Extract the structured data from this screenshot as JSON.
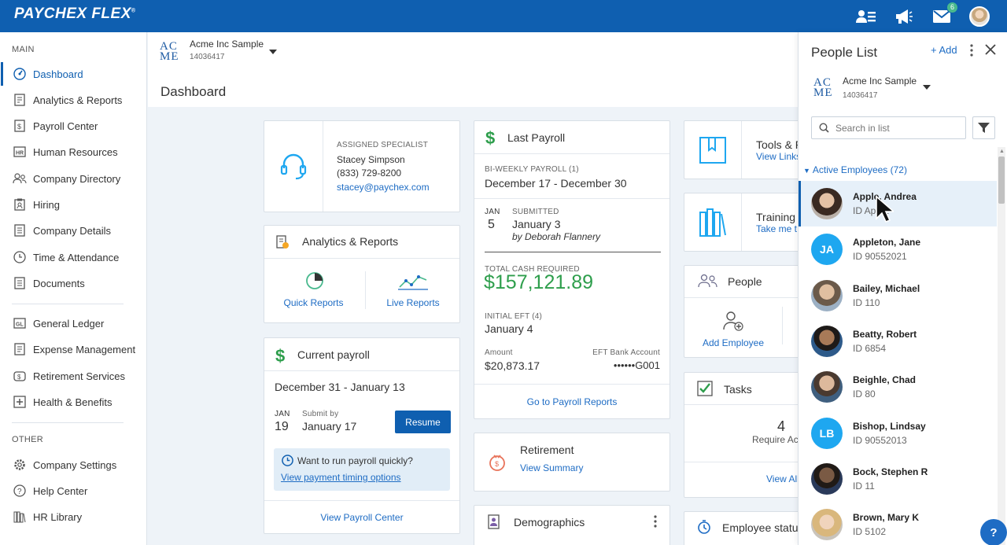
{
  "app": {
    "logo": "PAYCHEX FLEX",
    "logo_mark": "®"
  },
  "topbar": {
    "messages_badge": "6"
  },
  "sidebar": {
    "main_label": "MAIN",
    "other_label": "OTHER",
    "main_items": [
      {
        "label": "Dashboard",
        "icon": "dashboard-icon"
      },
      {
        "label": "Analytics & Reports",
        "icon": "report-icon"
      },
      {
        "label": "Payroll Center",
        "icon": "payroll-icon"
      },
      {
        "label": "Human Resources",
        "icon": "hr-icon"
      },
      {
        "label": "Company Directory",
        "icon": "directory-icon"
      },
      {
        "label": "Hiring",
        "icon": "hiring-icon"
      },
      {
        "label": "Company Details",
        "icon": "details-icon"
      },
      {
        "label": "Time & Attendance",
        "icon": "clock-icon"
      },
      {
        "label": "Documents",
        "icon": "documents-icon"
      },
      {
        "label": "General Ledger",
        "icon": "ledger-icon"
      },
      {
        "label": "Expense Management",
        "icon": "expense-icon"
      },
      {
        "label": "Retirement Services",
        "icon": "retirement-icon"
      },
      {
        "label": "Health & Benefits",
        "icon": "health-icon"
      }
    ],
    "other_items": [
      {
        "label": "Company Settings",
        "icon": "gear-icon"
      },
      {
        "label": "Help Center",
        "icon": "help-icon"
      },
      {
        "label": "HR Library",
        "icon": "library-icon"
      }
    ]
  },
  "company": {
    "logo_top": "AC",
    "logo_bottom": "ME",
    "name": "Acme Inc Sample",
    "id": "14036417"
  },
  "page_title": "Dashboard",
  "specialist": {
    "label": "ASSIGNED SPECIALIST",
    "name": "Stacey Simpson",
    "phone": "(833) 729-8200",
    "email": "stacey@paychex.com"
  },
  "analytics": {
    "title": "Analytics & Reports",
    "quick": "Quick Reports",
    "live": "Live Reports"
  },
  "current_payroll": {
    "title": "Current payroll",
    "period": "December 31 - January 13",
    "month": "JAN",
    "day": "19",
    "submit_label": "Submit by",
    "submit_date": "January 17",
    "button": "Resume",
    "quick_q": "Want to run payroll quickly?",
    "quick_link": "View payment timing options",
    "footer": "View Payroll Center"
  },
  "last_payroll": {
    "title": "Last Payroll",
    "freq": "BI-WEEKLY PAYROLL (1)",
    "period": "December 17 - December 30",
    "month": "JAN",
    "day": "5",
    "status": "SUBMITTED",
    "date": "January 3",
    "by": "by  Deborah Flannery",
    "cash_label": "TOTAL CASH REQUIRED",
    "cash": "$157,121.89",
    "eft_label": "INITIAL EFT (4)",
    "eft_date": "January 4",
    "amount_label": "Amount",
    "amount": "$20,873.17",
    "account_label": "EFT Bank Account",
    "account": "••••••G001",
    "footer": "Go to Payroll Reports"
  },
  "tools": {
    "title": "Tools & R",
    "link": "View Links"
  },
  "training": {
    "title": "Training",
    "link": "Take me t"
  },
  "people_card": {
    "title": "People",
    "add": "Add Employee"
  },
  "tasks": {
    "title": "Tasks",
    "count": "4",
    "sub": "Require Ac",
    "footer": "View All"
  },
  "employee_status": {
    "title": "Employee status"
  },
  "retirement": {
    "title": "Retirement",
    "link": "View Summary"
  },
  "demographics": {
    "title": "Demographics"
  },
  "people_list": {
    "title": "People List",
    "add": "+ Add",
    "search_placeholder": "Search in list",
    "group": "Active Employees (72)",
    "employees": [
      {
        "name": "Apple, Andrea",
        "id": "ID Ap    52",
        "initials": "",
        "color": "#7a5a48"
      },
      {
        "name": "Appleton, Jane",
        "id": "ID 90552021",
        "initials": "JA",
        "color": "#1ea7f0"
      },
      {
        "name": "Bailey, Michael",
        "id": "ID 110",
        "initials": "",
        "color": "#8a7a6a"
      },
      {
        "name": "Beatty, Robert",
        "id": "ID 6854",
        "initials": "",
        "color": "#5a4a3a"
      },
      {
        "name": "Beighle, Chad",
        "id": "ID 80",
        "initials": "",
        "color": "#6a6a5a"
      },
      {
        "name": "Bishop, Lindsay",
        "id": "ID 90552013",
        "initials": "LB",
        "color": "#1ea7f0"
      },
      {
        "name": "Bock, Stephen R",
        "id": "ID 11",
        "initials": "",
        "color": "#4a3a30"
      },
      {
        "name": "Brown, Mary K",
        "id": "ID 5102",
        "initials": "",
        "color": "#c9a880"
      }
    ]
  },
  "help": "?"
}
